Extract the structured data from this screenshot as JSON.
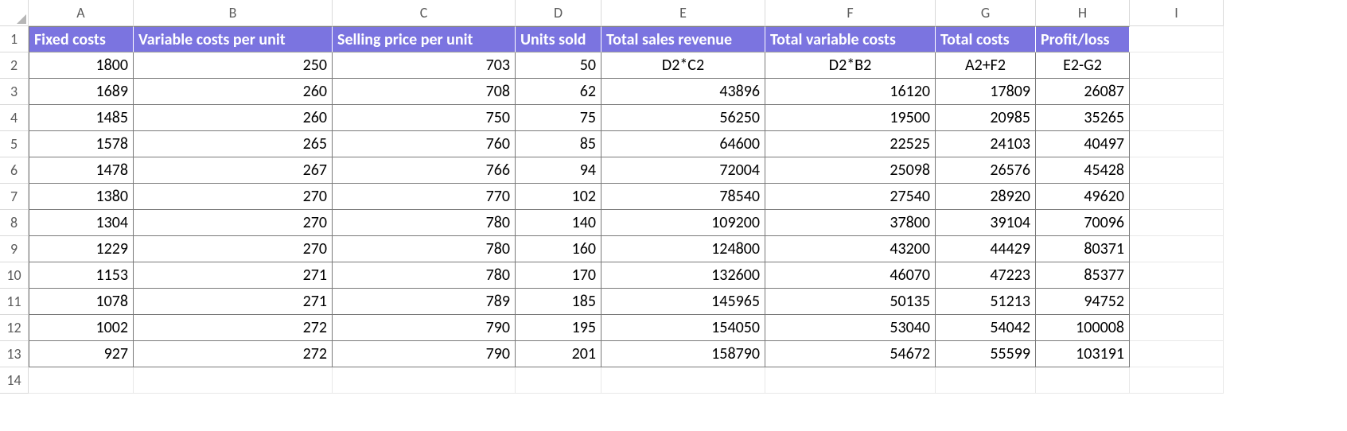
{
  "columns": [
    "A",
    "B",
    "C",
    "D",
    "E",
    "F",
    "G",
    "H",
    "I"
  ],
  "row_numbers": [
    1,
    2,
    3,
    4,
    5,
    6,
    7,
    8,
    9,
    10,
    11,
    12,
    13,
    14
  ],
  "headers": {
    "A": "Fixed costs",
    "B": "Variable costs per unit",
    "C": "Selling price per unit",
    "D": "Units sold",
    "E": "Total sales revenue",
    "F": "Total variable costs",
    "G": "Total costs",
    "H": "Profit/loss"
  },
  "rows": [
    {
      "A": "1800",
      "B": "250",
      "C": "703",
      "D": "50",
      "E": "D2*C2",
      "F": "D2*B2",
      "G": "A2+F2",
      "H": "E2-G2",
      "formula_row": true
    },
    {
      "A": "1689",
      "B": "260",
      "C": "708",
      "D": "62",
      "E": "43896",
      "F": "16120",
      "G": "17809",
      "H": "26087"
    },
    {
      "A": "1485",
      "B": "260",
      "C": "750",
      "D": "75",
      "E": "56250",
      "F": "19500",
      "G": "20985",
      "H": "35265"
    },
    {
      "A": "1578",
      "B": "265",
      "C": "760",
      "D": "85",
      "E": "64600",
      "F": "22525",
      "G": "24103",
      "H": "40497"
    },
    {
      "A": "1478",
      "B": "267",
      "C": "766",
      "D": "94",
      "E": "72004",
      "F": "25098",
      "G": "26576",
      "H": "45428"
    },
    {
      "A": "1380",
      "B": "270",
      "C": "770",
      "D": "102",
      "E": "78540",
      "F": "27540",
      "G": "28920",
      "H": "49620"
    },
    {
      "A": "1304",
      "B": "270",
      "C": "780",
      "D": "140",
      "E": "109200",
      "F": "37800",
      "G": "39104",
      "H": "70096"
    },
    {
      "A": "1229",
      "B": "270",
      "C": "780",
      "D": "160",
      "E": "124800",
      "F": "43200",
      "G": "44429",
      "H": "80371"
    },
    {
      "A": "1153",
      "B": "271",
      "C": "780",
      "D": "170",
      "E": "132600",
      "F": "46070",
      "G": "47223",
      "H": "85377"
    },
    {
      "A": "1078",
      "B": "271",
      "C": "789",
      "D": "185",
      "E": "145965",
      "F": "50135",
      "G": "51213",
      "H": "94752"
    },
    {
      "A": "1002",
      "B": "272",
      "C": "790",
      "D": "195",
      "E": "154050",
      "F": "53040",
      "G": "54042",
      "H": "100008"
    },
    {
      "A": "927",
      "B": "272",
      "C": "790",
      "D": "201",
      "E": "158790",
      "F": "54672",
      "G": "55599",
      "H": "103191"
    }
  ],
  "chart_data": {
    "type": "table",
    "title": "",
    "columns": [
      "Fixed costs",
      "Variable costs per unit",
      "Selling price per unit",
      "Units sold",
      "Total sales revenue",
      "Total variable costs",
      "Total costs",
      "Profit/loss"
    ],
    "data": [
      [
        1800,
        250,
        703,
        50,
        "D2*C2",
        "D2*B2",
        "A2+F2",
        "E2-G2"
      ],
      [
        1689,
        260,
        708,
        62,
        43896,
        16120,
        17809,
        26087
      ],
      [
        1485,
        260,
        750,
        75,
        56250,
        19500,
        20985,
        35265
      ],
      [
        1578,
        265,
        760,
        85,
        64600,
        22525,
        24103,
        40497
      ],
      [
        1478,
        267,
        766,
        94,
        72004,
        25098,
        26576,
        45428
      ],
      [
        1380,
        270,
        770,
        102,
        78540,
        27540,
        28920,
        49620
      ],
      [
        1304,
        270,
        780,
        140,
        109200,
        37800,
        39104,
        70096
      ],
      [
        1229,
        270,
        780,
        160,
        124800,
        43200,
        44429,
        80371
      ],
      [
        1153,
        271,
        780,
        170,
        132600,
        46070,
        47223,
        85377
      ],
      [
        1078,
        271,
        789,
        185,
        145965,
        50135,
        51213,
        94752
      ],
      [
        1002,
        272,
        790,
        195,
        154050,
        53040,
        54042,
        100008
      ],
      [
        927,
        272,
        790,
        201,
        158790,
        54672,
        55599,
        103191
      ]
    ]
  }
}
